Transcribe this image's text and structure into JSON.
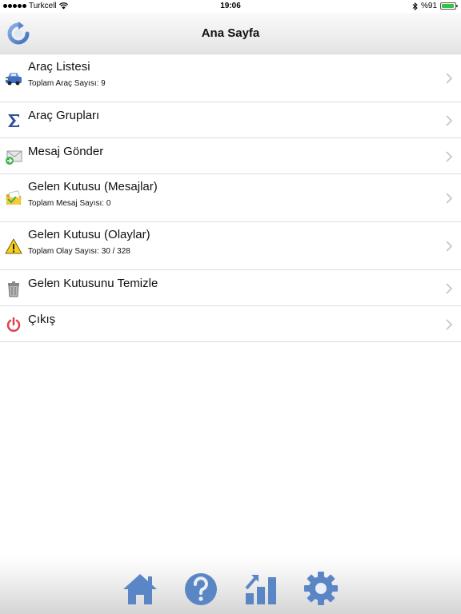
{
  "status_bar": {
    "carrier": "Turkcell",
    "time": "19:06",
    "battery_text": "%91",
    "battery_level": 0.91
  },
  "nav": {
    "title": "Ana Sayfa",
    "refresh_icon": "refresh-icon"
  },
  "menu": [
    {
      "title": "Araç Listesi",
      "subtitle": "Toplam Araç Sayısı: 9",
      "icon": "vehicle-icon"
    },
    {
      "title": "Araç Grupları",
      "subtitle": "",
      "icon": "sigma-icon"
    },
    {
      "title": "Mesaj Gönder",
      "subtitle": "",
      "icon": "send-mail-icon"
    },
    {
      "title": "Gelen Kutusu (Mesajlar)",
      "subtitle": "Toplam Mesaj Sayısı: 0",
      "icon": "folder-icon"
    },
    {
      "title": "Gelen Kutusu (Olaylar)",
      "subtitle": "Toplam Olay Sayısı: 30 / 328",
      "icon": "warning-icon"
    },
    {
      "title": "Gelen Kutusunu Temizle",
      "subtitle": "",
      "icon": "trash-icon"
    },
    {
      "title": "Çıkış",
      "subtitle": "",
      "icon": "power-icon"
    }
  ],
  "tabs": [
    {
      "icon": "home-icon"
    },
    {
      "icon": "help-icon"
    },
    {
      "icon": "stats-icon"
    },
    {
      "icon": "settings-gear-icon"
    }
  ],
  "colors": {
    "tab_icon_blue": "#5b86c6",
    "chevron": "#c7c7cc",
    "battery_green": "#35c245",
    "power_red": "#e0414f",
    "warning_yellow": "#f5cf1c"
  }
}
